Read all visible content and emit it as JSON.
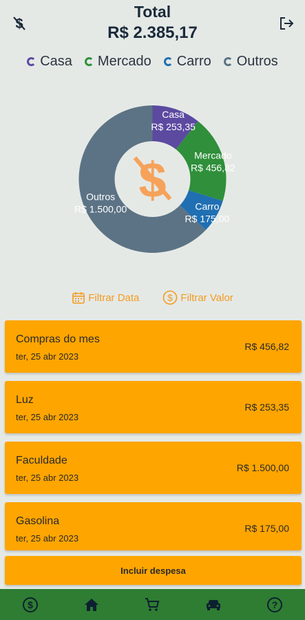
{
  "header": {
    "title": "Total",
    "total": "R$ 2.385,17"
  },
  "legend": [
    {
      "label": "Casa",
      "color": "#5b4aa0"
    },
    {
      "label": "Mercado",
      "color": "#2f8f3a"
    },
    {
      "label": "Carro",
      "color": "#1f6fb2"
    },
    {
      "label": "Outros",
      "color": "#5c7385"
    }
  ],
  "chart_data": {
    "type": "pie",
    "categories": [
      "Casa",
      "Mercado",
      "Carro",
      "Outros"
    ],
    "values": [
      253.35,
      456.82,
      175.0,
      1500.0
    ],
    "labels": [
      {
        "name": "Casa",
        "value": "R$ 253,35"
      },
      {
        "name": "Mercado",
        "value": "R$ 456,82"
      },
      {
        "name": "Carro",
        "value": "R$ 175,00"
      },
      {
        "name": "Outros",
        "value": "R$ 1.500,00"
      }
    ],
    "colors": [
      "#5b4aa0",
      "#2f8f3a",
      "#1f6fb2",
      "#5c7385"
    ],
    "center_icon": "no-money-icon",
    "legend_position": "top"
  },
  "filters": {
    "date_label": "Filtrar Data",
    "value_label": "Filtrar Valor"
  },
  "expenses": [
    {
      "title": "Compras do mes",
      "date": "ter, 25 abr 2023",
      "value": "R$ 456,82"
    },
    {
      "title": "Luz",
      "date": "ter, 25 abr 2023",
      "value": "R$ 253,35"
    },
    {
      "title": "Faculdade",
      "date": "ter, 25 abr 2023",
      "value": "R$ 1.500,00"
    },
    {
      "title": "Gasolina",
      "date": "ter, 25 abr 2023",
      "value": "R$ 175,00"
    }
  ],
  "add_button": "Incluir despesa",
  "nav": [
    "money-icon",
    "home-icon",
    "cart-icon",
    "car-icon",
    "help-icon"
  ],
  "colors": {
    "accent": "#ffa500",
    "nav": "#2e7d32",
    "background": "#e5e9e6"
  }
}
